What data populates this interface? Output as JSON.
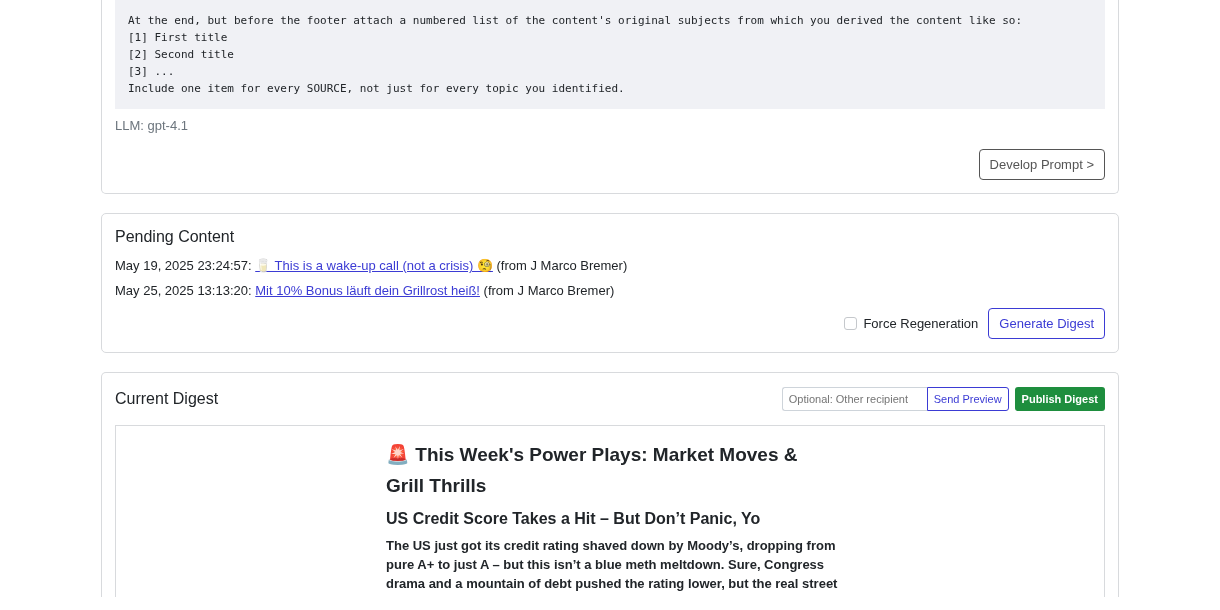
{
  "prompt_card": {
    "prompt_lines": [
      "At the end, but before the footer attach a numbered list of the content's original subjects from which you derived the content like so:",
      "[1] First title",
      "[2] Second title",
      "[3] ...",
      "Include one item for every SOURCE, not just for every topic you identified."
    ],
    "llm": "LLM: gpt-4.1",
    "button": "Develop Prompt >"
  },
  "pending": {
    "title": "Pending Content",
    "items": [
      {
        "date": "May 19, 2025 23:24:57:",
        "link": " 🥛 This is a wake-up call (not a crisis) 🧐",
        "from": "(from J Marco Bremer)"
      },
      {
        "date": "May 25, 2025 13:13:20:",
        "link": "Mit 10% Bonus läuft dein Grillrost heiß!",
        "from": "(from J Marco Bremer)"
      }
    ],
    "force_regeneration": {
      "label": "Force Regeneration",
      "checked": false
    },
    "button": "Generate Digest"
  },
  "digest": {
    "title": "Current Digest",
    "recipient_placeholder": "Optional: Other recipient",
    "send_button": "Send Preview",
    "publish_button": "Publish Digest",
    "headline": "🚨 This Week's Power Plays: Market Moves & Grill Thrills",
    "subheadline": "US Credit Score Takes a Hit – But Don’t Panic, Yo",
    "body": "The US just got its credit rating shaved down by Moody’s, dropping from pure A+ to just A – but this isn’t a blue meth meltdown. Sure, Congress drama and a mountain of debt pushed the rating lower, but the real street"
  }
}
